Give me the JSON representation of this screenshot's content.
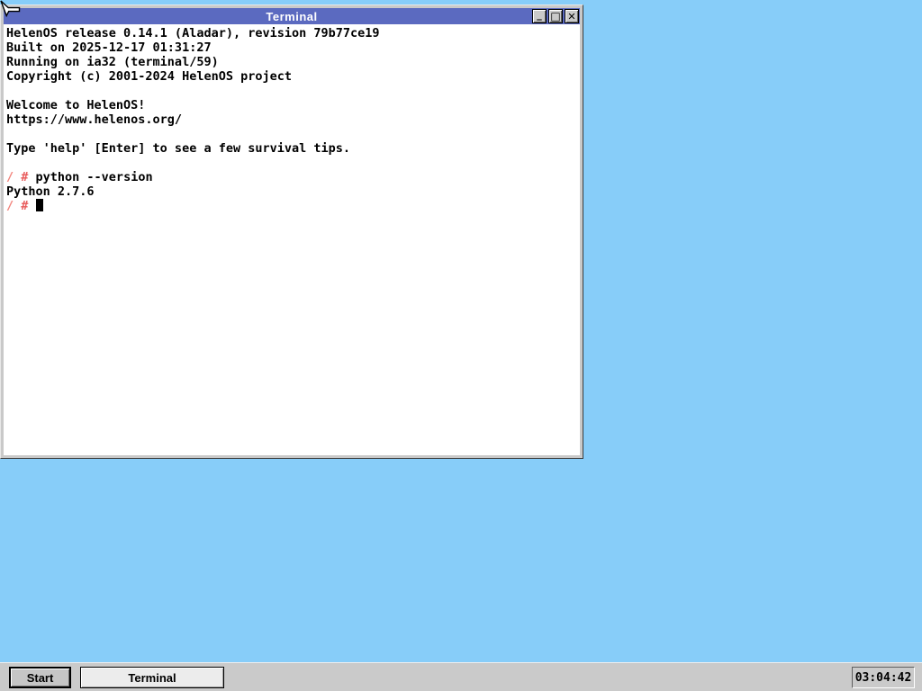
{
  "desktop": {
    "bg_color": "#87cdf9"
  },
  "window": {
    "title": "Terminal",
    "titlebar_color": "#5b6ac0",
    "controls": [
      {
        "name": "minimize-icon",
        "glyph": "_"
      },
      {
        "name": "maximize-icon",
        "glyph": "□"
      },
      {
        "name": "close-icon",
        "glyph": "✕"
      }
    ]
  },
  "terminal": {
    "prompt_slash_color": "#f2837c",
    "prompt_hash_color": "#e85c5c",
    "lines": [
      [
        {
          "t": "HelenOS release 0.14.1 (Aladar), revision 79b77ce19"
        }
      ],
      [
        {
          "t": "Built on 2025-12-17 01:31:27"
        }
      ],
      [
        {
          "t": "Running on ia32 (terminal/59)"
        }
      ],
      [
        {
          "t": "Copyright (c) 2001-2024 HelenOS project"
        }
      ],
      [],
      [
        {
          "t": "Welcome to HelenOS!"
        }
      ],
      [
        {
          "t": "https://www.helenos.org/"
        }
      ],
      [],
      [
        {
          "t": "Type 'help' [Enter] to see a few survival tips."
        }
      ],
      [],
      [
        {
          "t": "/ ",
          "c": "#f2837c"
        },
        {
          "t": "# ",
          "c": "#e85c5c"
        },
        {
          "t": "python --version"
        }
      ],
      [
        {
          "t": "Python 2.7.6"
        }
      ],
      [
        {
          "t": "/ ",
          "c": "#f2837c"
        },
        {
          "t": "# ",
          "c": "#e85c5c"
        },
        {
          "cursor": true
        }
      ]
    ]
  },
  "taskbar": {
    "start_label": "Start",
    "tasks": [
      {
        "label": "Terminal",
        "active": true
      }
    ],
    "clock": "03:04:42"
  }
}
